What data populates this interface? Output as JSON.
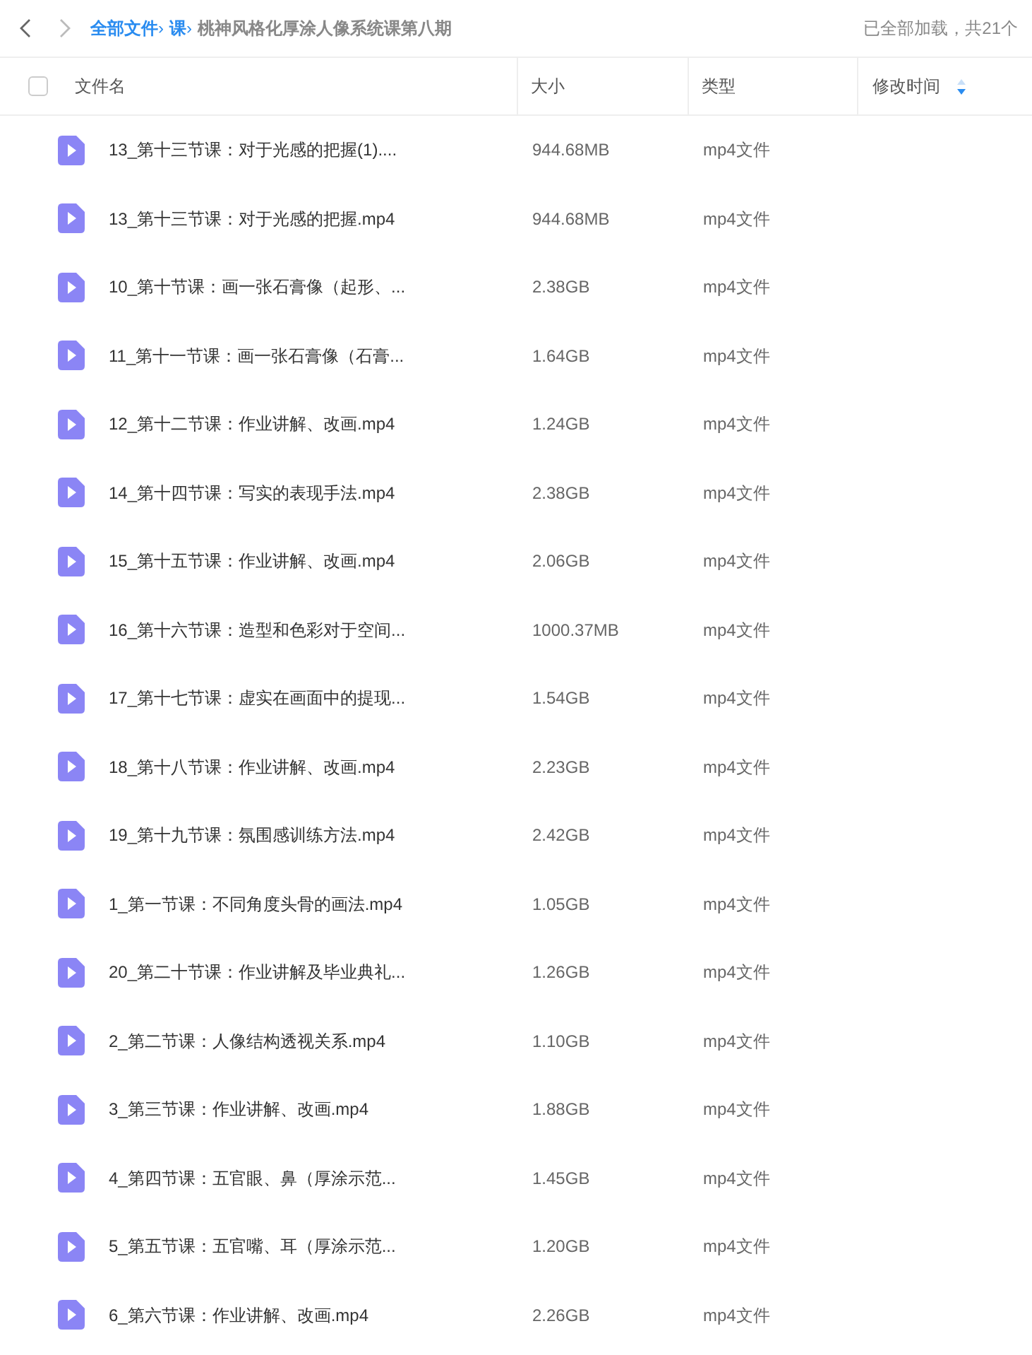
{
  "breadcrumb_separator": "›",
  "breadcrumb": [
    {
      "label": "全部文件",
      "kind": "link"
    },
    {
      "label": "课",
      "kind": "link"
    },
    {
      "label": "桃神风格化厚涂人像系统课第八期",
      "kind": "current"
    }
  ],
  "status": "已全部加载，共21个",
  "table": {
    "select_all_checked": false,
    "columns": [
      "文件名",
      "大小",
      "类型",
      "修改时间"
    ],
    "rows": [
      {
        "name": "13_第十三节课：对于光感的把握(1)....",
        "size": "944.68MB",
        "type": "mp4文件"
      },
      {
        "name": "13_第十三节课：对于光感的把握.mp4",
        "size": "944.68MB",
        "type": "mp4文件"
      },
      {
        "name": "10_第十节课：画一张石膏像（起形、...",
        "size": "2.38GB",
        "type": "mp4文件"
      },
      {
        "name": "11_第十一节课：画一张石膏像（石膏...",
        "size": "1.64GB",
        "type": "mp4文件"
      },
      {
        "name": "12_第十二节课：作业讲解、改画.mp4",
        "size": "1.24GB",
        "type": "mp4文件"
      },
      {
        "name": "14_第十四节课：写实的表现手法.mp4",
        "size": "2.38GB",
        "type": "mp4文件"
      },
      {
        "name": "15_第十五节课：作业讲解、改画.mp4",
        "size": "2.06GB",
        "type": "mp4文件"
      },
      {
        "name": "16_第十六节课：造型和色彩对于空间...",
        "size": "1000.37MB",
        "type": "mp4文件"
      },
      {
        "name": "17_第十七节课：虚实在画面中的提现...",
        "size": "1.54GB",
        "type": "mp4文件"
      },
      {
        "name": "18_第十八节课：作业讲解、改画.mp4",
        "size": "2.23GB",
        "type": "mp4文件"
      },
      {
        "name": "19_第十九节课：氛围感训练方法.mp4",
        "size": "2.42GB",
        "type": "mp4文件"
      },
      {
        "name": "1_第一节课：不同角度头骨的画法.mp4",
        "size": "1.05GB",
        "type": "mp4文件"
      },
      {
        "name": "20_第二十节课：作业讲解及毕业典礼...",
        "size": "1.26GB",
        "type": "mp4文件"
      },
      {
        "name": "2_第二节课：人像结构透视关系.mp4",
        "size": "1.10GB",
        "type": "mp4文件"
      },
      {
        "name": "3_第三节课：作业讲解、改画.mp4",
        "size": "1.88GB",
        "type": "mp4文件"
      },
      {
        "name": "4_第四节课：五官眼、鼻（厚涂示范...",
        "size": "1.45GB",
        "type": "mp4文件"
      },
      {
        "name": "5_第五节课：五官嘴、耳（厚涂示范...",
        "size": "1.20GB",
        "type": "mp4文件"
      },
      {
        "name": "6_第六节课：作业讲解、改画.mp4",
        "size": "2.26GB",
        "type": "mp4文件"
      }
    ]
  }
}
